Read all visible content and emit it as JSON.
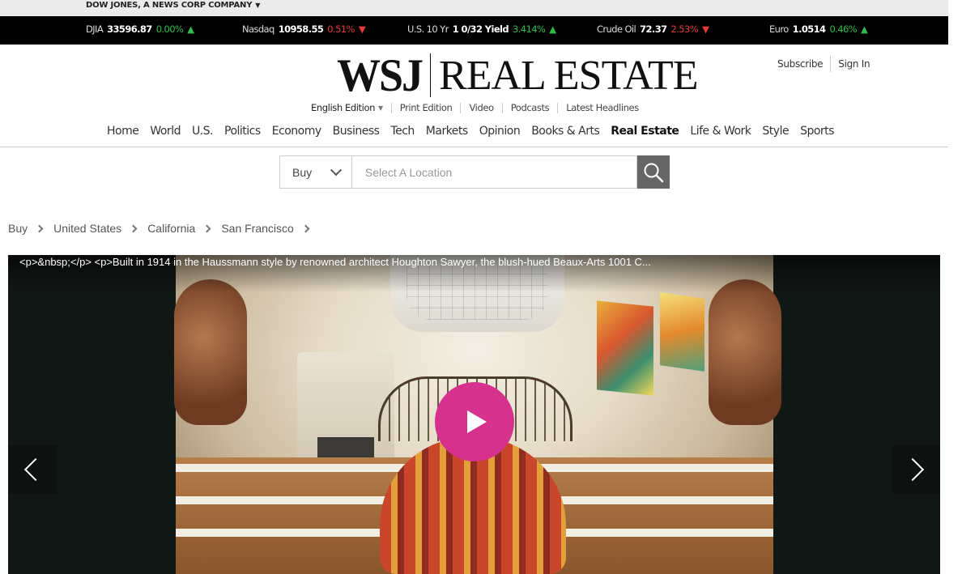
{
  "corp_bar": {
    "label": "DOW JONES, A NEWS CORP COMPANY"
  },
  "ticker": [
    {
      "name": "DJIA",
      "value": "33596.87",
      "change": "0.00%",
      "arrow": "▲",
      "direction": "up"
    },
    {
      "name": "Nasdaq",
      "value": "10958.55",
      "change": "0.51%",
      "arrow": "▼",
      "direction": "down"
    },
    {
      "name": "U.S. 10 Yr",
      "value": "1 0/32 Yield",
      "change": "3.414%",
      "arrow": "▲",
      "direction": "up"
    },
    {
      "name": "Crude Oil",
      "value": "72.37",
      "change": "2.53%",
      "arrow": "▼",
      "direction": "down"
    },
    {
      "name": "Euro",
      "value": "1.0514",
      "change": "0.46%",
      "arrow": "▲",
      "direction": "up"
    }
  ],
  "masthead": {
    "logo_main": "WSJ",
    "logo_section": "REAL ESTATE",
    "subscribe": "Subscribe",
    "sign_in": "Sign In"
  },
  "subnav": {
    "edition": "English Edition",
    "items": [
      "Print Edition",
      "Video",
      "Podcasts",
      "Latest Headlines"
    ]
  },
  "mainnav": [
    "Home",
    "World",
    "U.S.",
    "Politics",
    "Economy",
    "Business",
    "Tech",
    "Markets",
    "Opinion",
    "Books & Arts",
    "Real Estate",
    "Life & Work",
    "Style",
    "Sports"
  ],
  "mainnav_active": "Real Estate",
  "search": {
    "type_value": "Buy",
    "placeholder": "Select A Location"
  },
  "breadcrumb": [
    "Buy",
    "United States",
    "California",
    "San Francisco"
  ],
  "gallery": {
    "caption": "<p>&nbsp;</p> <p>Built in 1914 in the Haussmann style by renowned architect Houghton Sawyer, the blush-hued Beaux-Arts 1001 C..."
  },
  "colors": {
    "up": "#2fbe4b",
    "down": "#e33b3b",
    "play_button": "#d6318d"
  }
}
